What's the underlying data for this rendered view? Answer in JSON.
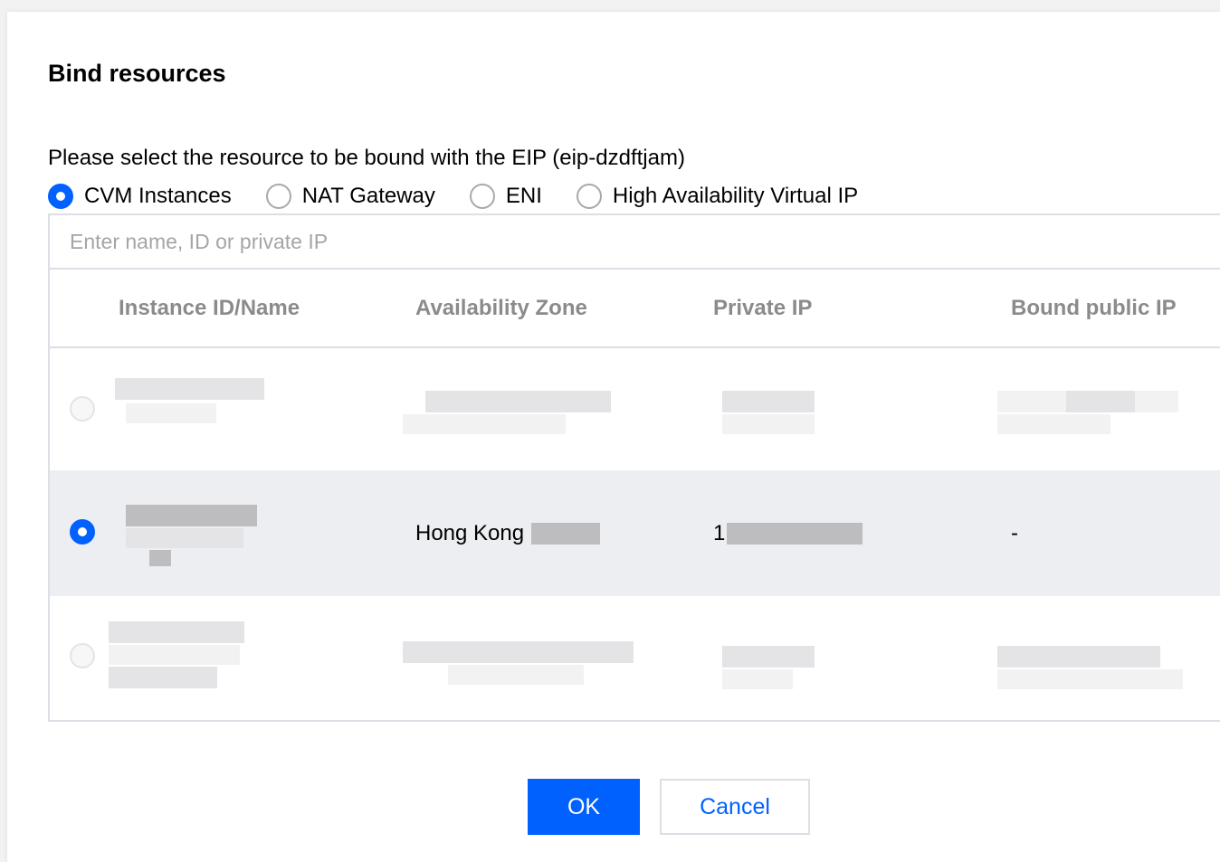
{
  "dialog": {
    "title": "Bind resources",
    "description": "Please select the resource to be bound with the EIP (eip-dzdftjam)"
  },
  "resource_types": {
    "selected": "CVM Instances",
    "options": [
      "CVM Instances",
      "NAT Gateway",
      "ENI",
      "High Availability Virtual IP"
    ]
  },
  "search": {
    "placeholder": "Enter name, ID or private IP",
    "value": ""
  },
  "table": {
    "columns": [
      "Instance ID/Name",
      "Availability Zone",
      "Private IP",
      "Bound public IP"
    ],
    "rows": [
      {
        "state": "disabled",
        "instance": "",
        "zone": "",
        "private_ip": "",
        "public_ip": ""
      },
      {
        "state": "selected",
        "instance": "",
        "zone": "Hong Kong",
        "private_ip": "1",
        "public_ip": "-"
      },
      {
        "state": "disabled",
        "instance": "",
        "zone": "",
        "private_ip": "",
        "public_ip": ""
      }
    ]
  },
  "buttons": {
    "ok": "OK",
    "cancel": "Cancel"
  },
  "colors": {
    "accent": "#0061ff",
    "header_text": "#8b8b8b",
    "selected_row": "#edeef2",
    "border": "#dcdfe6"
  }
}
